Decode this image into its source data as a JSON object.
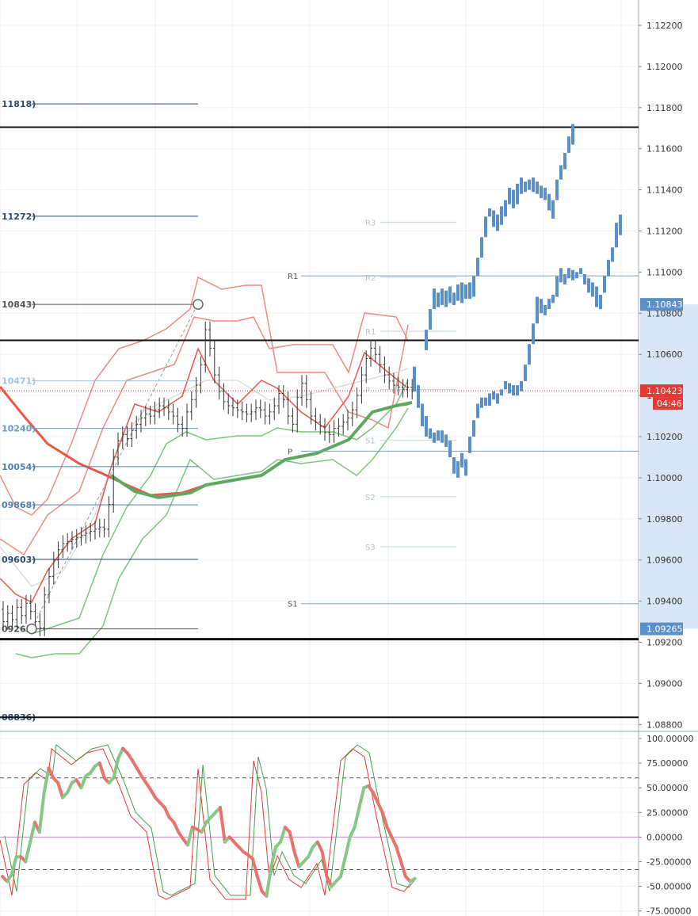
{
  "chart_data": [
    {
      "type": "candlestick",
      "ylim": [
        1.0875,
        1.1235
      ],
      "y_ticks": [
        "1.12200",
        "1.12000",
        "1.11800",
        "1.11600",
        "1.11400",
        "1.11200",
        "1.11000",
        "1.10800",
        "1.10600",
        "1.10400",
        "1.10200",
        "1.10000",
        "1.09800",
        "1.09600",
        "1.09400",
        "1.09200",
        "1.09000",
        "1.08800"
      ],
      "grid": true,
      "fib_levels": [
        {
          "label": "11818)",
          "value": 1.11818,
          "color": "#2a4a6b"
        },
        {
          "label": "11272)",
          "value": 1.11272,
          "color": "#2a4a6b"
        },
        {
          "label": "10843)",
          "value": 1.10843,
          "color": "#555555"
        },
        {
          "label": "10471)",
          "value": 1.10471,
          "color": "#9fc3e0"
        },
        {
          "label": "10240)",
          "value": 1.1024,
          "color": "#6a9cc9"
        },
        {
          "label": "10054)",
          "value": 1.10054,
          "color": "#4a7fb0"
        },
        {
          "label": "09868)",
          "value": 1.09868,
          "color": "#4a7fb0"
        },
        {
          "label": "09603)",
          "value": 1.09603,
          "color": "#2a4a6b"
        },
        {
          "label": "09265)",
          "value": 1.09265,
          "color": "#555555"
        },
        {
          "label": "08836)",
          "value": 1.08836,
          "color": "#2a4a6b"
        }
      ],
      "horizontal_lines": [
        1.11705,
        1.10668,
        1.09215,
        1.08835
      ],
      "pivots_left": [
        {
          "label": "R1",
          "value": 1.10982
        },
        {
          "label": "P",
          "value": 1.10129
        },
        {
          "label": "S1",
          "value": 1.09388
        }
      ],
      "pivots_right": [
        {
          "label": "R3",
          "value": 1.11243
        },
        {
          "label": "R2",
          "value": 1.10975
        },
        {
          "label": "R1",
          "value": 1.10712
        },
        {
          "label": "P",
          "value": 1.1043
        },
        {
          "label": "S1",
          "value": 1.10183
        },
        {
          "label": "S2",
          "value": 1.09908
        },
        {
          "label": "S3",
          "value": 1.09665
        }
      ],
      "price_badges": [
        {
          "label": "1.10843",
          "value": 1.10843,
          "color": "#5b8fc7"
        },
        {
          "label": "1.10423",
          "value": 1.10423,
          "color": "#e53935"
        },
        {
          "label": "1.09265",
          "value": 1.09265,
          "color": "#5b8fc7"
        }
      ],
      "countdown": "04:46",
      "current_price": 1.10423,
      "candles": [
        {
          "o": 1.0936,
          "c": 1.093
        },
        {
          "o": 1.093,
          "c": 1.0934
        },
        {
          "o": 1.0934,
          "c": 1.0931
        },
        {
          "o": 1.0931,
          "c": 1.0937
        },
        {
          "o": 1.0937,
          "c": 1.0933
        },
        {
          "o": 1.0933,
          "c": 1.0939
        },
        {
          "o": 1.0939,
          "c": 1.0935
        },
        {
          "o": 1.0935,
          "c": 1.093
        },
        {
          "o": 1.093,
          "c": 1.0927
        },
        {
          "o": 1.0927,
          "c": 1.0943
        },
        {
          "o": 1.0943,
          "c": 1.0952
        },
        {
          "o": 1.0952,
          "c": 1.096
        },
        {
          "o": 1.096,
          "c": 1.0965
        },
        {
          "o": 1.0965,
          "c": 1.0968
        },
        {
          "o": 1.0968,
          "c": 1.0969
        },
        {
          "o": 1.0969,
          "c": 1.097
        },
        {
          "o": 1.097,
          "c": 1.0971
        },
        {
          "o": 1.0971,
          "c": 1.0972
        },
        {
          "o": 1.0972,
          "c": 1.0973
        },
        {
          "o": 1.0973,
          "c": 1.0974
        },
        {
          "o": 1.0974,
          "c": 1.0975
        },
        {
          "o": 1.0975,
          "c": 1.0976
        },
        {
          "o": 1.0976,
          "c": 1.0975
        },
        {
          "o": 1.0975,
          "c": 1.0987
        },
        {
          "o": 1.0987,
          "c": 1.101
        },
        {
          "o": 1.101,
          "c": 1.1018
        },
        {
          "o": 1.1018,
          "c": 1.1021
        },
        {
          "o": 1.1021,
          "c": 1.1019
        },
        {
          "o": 1.1019,
          "c": 1.1023
        },
        {
          "o": 1.1023,
          "c": 1.1026
        },
        {
          "o": 1.1026,
          "c": 1.1029
        },
        {
          "o": 1.1029,
          "c": 1.1031
        },
        {
          "o": 1.1031,
          "c": 1.103
        },
        {
          "o": 1.103,
          "c": 1.1033
        },
        {
          "o": 1.1033,
          "c": 1.1035
        },
        {
          "o": 1.1035,
          "c": 1.1034
        },
        {
          "o": 1.1034,
          "c": 1.1032
        },
        {
          "o": 1.1032,
          "c": 1.103
        },
        {
          "o": 1.103,
          "c": 1.1026
        },
        {
          "o": 1.1026,
          "c": 1.1024
        },
        {
          "o": 1.1024,
          "c": 1.1032
        },
        {
          "o": 1.1032,
          "c": 1.1038
        },
        {
          "o": 1.1038,
          "c": 1.1045
        },
        {
          "o": 1.1045,
          "c": 1.1055
        },
        {
          "o": 1.1055,
          "c": 1.1072
        },
        {
          "o": 1.1072,
          "c": 1.1063
        },
        {
          "o": 1.1063,
          "c": 1.105
        },
        {
          "o": 1.105,
          "c": 1.1042
        },
        {
          "o": 1.1042,
          "c": 1.1037
        },
        {
          "o": 1.1037,
          "c": 1.1035
        },
        {
          "o": 1.1035,
          "c": 1.1034
        },
        {
          "o": 1.1034,
          "c": 1.1033
        },
        {
          "o": 1.1033,
          "c": 1.1032
        },
        {
          "o": 1.1032,
          "c": 1.1031
        },
        {
          "o": 1.1031,
          "c": 1.1032
        },
        {
          "o": 1.1032,
          "c": 1.1034
        },
        {
          "o": 1.1034,
          "c": 1.1033
        },
        {
          "o": 1.1033,
          "c": 1.103
        },
        {
          "o": 1.103,
          "c": 1.1032
        },
        {
          "o": 1.1032,
          "c": 1.1035
        },
        {
          "o": 1.1035,
          "c": 1.1041
        },
        {
          "o": 1.1041,
          "c": 1.1038
        },
        {
          "o": 1.1038,
          "c": 1.103
        },
        {
          "o": 1.103,
          "c": 1.1026
        },
        {
          "o": 1.1026,
          "c": 1.1039
        },
        {
          "o": 1.1039,
          "c": 1.1046
        },
        {
          "o": 1.1046,
          "c": 1.1038
        },
        {
          "o": 1.1038,
          "c": 1.103
        },
        {
          "o": 1.103,
          "c": 1.1027
        },
        {
          "o": 1.1027,
          "c": 1.1025
        },
        {
          "o": 1.1025,
          "c": 1.1022
        },
        {
          "o": 1.1022,
          "c": 1.1021
        },
        {
          "o": 1.1021,
          "c": 1.1024
        },
        {
          "o": 1.1024,
          "c": 1.1025
        },
        {
          "o": 1.1025,
          "c": 1.1027
        },
        {
          "o": 1.1027,
          "c": 1.1029
        },
        {
          "o": 1.1029,
          "c": 1.1033
        },
        {
          "o": 1.1033,
          "c": 1.104
        },
        {
          "o": 1.104,
          "c": 1.105
        },
        {
          "o": 1.105,
          "c": 1.1058
        },
        {
          "o": 1.1058,
          "c": 1.1063
        },
        {
          "o": 1.1063,
          "c": 1.106
        },
        {
          "o": 1.106,
          "c": 1.1055
        },
        {
          "o": 1.1055,
          "c": 1.105
        },
        {
          "o": 1.105,
          "c": 1.1047
        },
        {
          "o": 1.1047,
          "c": 1.1045
        },
        {
          "o": 1.1045,
          "c": 1.1044
        },
        {
          "o": 1.1044,
          "c": 1.1043
        },
        {
          "o": 1.1043,
          "c": 1.1044
        },
        {
          "o": 1.1044,
          "c": 1.1042
        }
      ],
      "renko_upper": [
        [
          1.1062,
          1.1072
        ],
        [
          1.1072,
          1.1082
        ],
        [
          1.1082,
          1.1092
        ],
        [
          1.1083,
          1.109
        ],
        [
          1.1084,
          1.1092
        ],
        [
          1.1083,
          1.1091
        ],
        [
          1.1085,
          1.1093
        ],
        [
          1.1084,
          1.109
        ],
        [
          1.1086,
          1.1094
        ],
        [
          1.1085,
          1.1095
        ],
        [
          1.1087,
          1.1094
        ],
        [
          1.1087,
          1.1095
        ],
        [
          1.1088,
          1.1098
        ],
        [
          1.1098,
          1.1107
        ],
        [
          1.1107,
          1.1117
        ],
        [
          1.1117,
          1.1127
        ],
        [
          1.1127,
          1.1131
        ],
        [
          1.1122,
          1.113
        ],
        [
          1.112,
          1.1128
        ],
        [
          1.1123,
          1.1132
        ],
        [
          1.1127,
          1.1135
        ],
        [
          1.1133,
          1.1141
        ],
        [
          1.1131,
          1.114
        ],
        [
          1.1133,
          1.1143
        ],
        [
          1.1138,
          1.1146
        ],
        [
          1.1139,
          1.1144
        ],
        [
          1.114,
          1.1145
        ],
        [
          1.1139,
          1.1146
        ],
        [
          1.1138,
          1.1144
        ],
        [
          1.1136,
          1.1142
        ],
        [
          1.1135,
          1.1141
        ],
        [
          1.113,
          1.1138
        ],
        [
          1.1126,
          1.1135
        ],
        [
          1.1135,
          1.1145
        ],
        [
          1.1145,
          1.1152
        ],
        [
          1.115,
          1.1158
        ],
        [
          1.1158,
          1.1166
        ],
        [
          1.1162,
          1.1172
        ]
      ],
      "renko_lower": [
        [
          1.1042,
          1.1054
        ],
        [
          1.1034,
          1.1045
        ],
        [
          1.1025,
          1.1036
        ],
        [
          1.102,
          1.103
        ],
        [
          1.1019,
          1.1024
        ],
        [
          1.1017,
          1.1022
        ],
        [
          1.1018,
          1.1023
        ],
        [
          1.1017,
          1.1023
        ],
        [
          1.1015,
          1.1021
        ],
        [
          1.101,
          1.1018
        ],
        [
          1.1002,
          1.101
        ],
        [
          1.1,
          1.1008
        ],
        [
          1.1005,
          1.1012
        ],
        [
          1.1001,
          1.1009
        ],
        [
          1.1012,
          1.102
        ],
        [
          1.102,
          1.1028
        ],
        [
          1.1029,
          1.1036
        ],
        [
          1.1034,
          1.1039
        ],
        [
          1.1035,
          1.1039
        ],
        [
          1.1035,
          1.1041
        ],
        [
          1.1038,
          1.1042
        ],
        [
          1.1036,
          1.1041
        ],
        [
          1.104,
          1.1043
        ],
        [
          1.1043,
          1.1047
        ],
        [
          1.1041,
          1.1046
        ],
        [
          1.104,
          1.1045
        ],
        [
          1.104,
          1.1045
        ],
        [
          1.1042,
          1.1047
        ],
        [
          1.1047,
          1.1055
        ],
        [
          1.1055,
          1.1065
        ],
        [
          1.1065,
          1.1075
        ],
        [
          1.1075,
          1.1088
        ],
        [
          1.108,
          1.1087
        ],
        [
          1.1079,
          1.1084
        ],
        [
          1.1082,
          1.1087
        ],
        [
          1.1085,
          1.1089
        ],
        [
          1.1088,
          1.1098
        ],
        [
          1.1095,
          1.1102
        ],
        [
          1.1094,
          1.1099
        ],
        [
          1.1097,
          1.1102
        ],
        [
          1.1096,
          1.1101
        ],
        [
          1.1097,
          1.11
        ],
        [
          1.1099,
          1.1102
        ],
        [
          1.1094,
          1.1099
        ],
        [
          1.109,
          1.1097
        ],
        [
          1.1088,
          1.1095
        ],
        [
          1.1083,
          1.1093
        ],
        [
          1.1082,
          1.1089
        ],
        [
          1.109,
          1.1098
        ],
        [
          1.1098,
          1.1106
        ],
        [
          1.1105,
          1.1112
        ],
        [
          1.1112,
          1.1124
        ],
        [
          1.1118,
          1.1128
        ]
      ]
    },
    {
      "type": "line",
      "ylim": [
        -80,
        102
      ],
      "y_ticks": [
        "100.00000",
        "75.00000",
        "50.00000",
        "25.00000",
        "0.00000",
        "-25.00000",
        "-50.00000",
        "-75.00000"
      ],
      "ref_lines": [
        60,
        0,
        -33
      ],
      "series": [
        {
          "values": [
            -40,
            -45,
            -38,
            -20,
            -20,
            -25,
            -5,
            15,
            5,
            45,
            70,
            60,
            55,
            40,
            45,
            55,
            58,
            50,
            62,
            65,
            72,
            75,
            60,
            55,
            60,
            80,
            90,
            85,
            78,
            70,
            62,
            55,
            48,
            40,
            35,
            30,
            20,
            15,
            5,
            -2,
            -8,
            10,
            8,
            5,
            15,
            20,
            25,
            30,
            -5,
            0,
            -5,
            -10,
            -15,
            -18,
            -22,
            -40,
            -55,
            -60,
            -30,
            -10,
            -5,
            10,
            5,
            -15,
            -30,
            -25,
            -20,
            -10,
            -5,
            -15,
            -40,
            -50,
            -45,
            -40,
            -20,
            0,
            10,
            30,
            50,
            52,
            45,
            35,
            25,
            10,
            0,
            -10,
            -25,
            -40,
            -45,
            -42
          ]
        }
      ]
    }
  ]
}
